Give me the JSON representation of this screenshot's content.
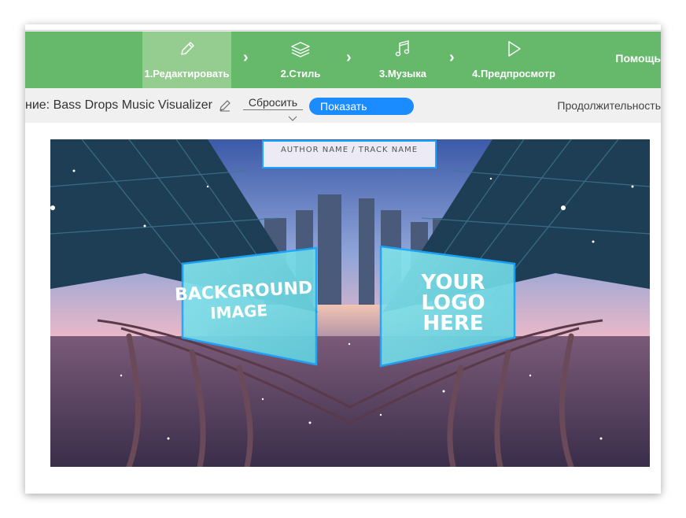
{
  "nav": {
    "steps": [
      {
        "label": "1.Редактировать",
        "icon": "pencil-icon",
        "active": true
      },
      {
        "label": "2.Стиль",
        "icon": "layers-icon",
        "active": false
      },
      {
        "label": "3.Музыка",
        "icon": "music-note-icon",
        "active": false
      },
      {
        "label": "4.Предпросмотр",
        "icon": "play-icon",
        "active": false
      }
    ],
    "help_label": "Помощь"
  },
  "toolbar": {
    "project_name": "ние: Bass Drops Music Visualizer",
    "reset_label": "Сбросить",
    "show_label": "Показать",
    "duration_label": "Продолжительность"
  },
  "preview": {
    "track_placeholder": "AUTHOR NAME / TRACK NAME",
    "background_placeholder_line1": "BACKGROUND",
    "background_placeholder_line2": "IMAGE",
    "logo_placeholder_line1": "YOUR",
    "logo_placeholder_line2": "LOGO",
    "logo_placeholder_line3": "HERE"
  },
  "colors": {
    "nav_green": "#66b96b",
    "nav_active": "#95cc90",
    "show_button": "#1a8cff",
    "panel_cyan": "#7fe0e8",
    "panel_border": "#1aa7ff"
  }
}
